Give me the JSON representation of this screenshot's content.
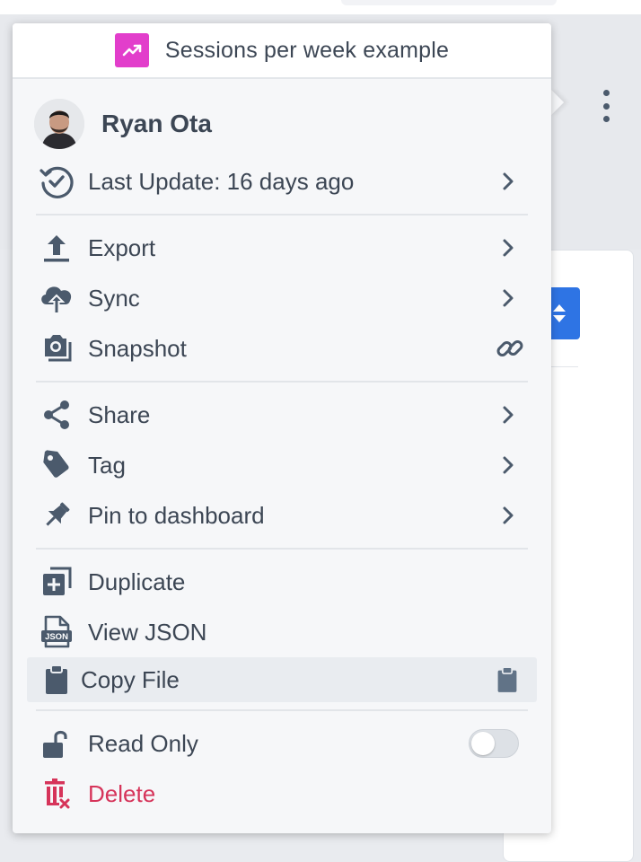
{
  "colors": {
    "text": "#3c4654",
    "icon": "#4b5a6c",
    "chart_badge": "#e23ecb",
    "danger": "#d6345a",
    "accent_blue": "#2e74e4"
  },
  "header": {
    "icon": "line-chart-icon",
    "title": "Sessions per week example"
  },
  "user": {
    "name": "Ryan Ota"
  },
  "menu": {
    "last_update": {
      "label": "Last Update: 16 days ago",
      "icon": "history-check-icon"
    },
    "export": {
      "label": "Export",
      "icon": "upload-icon"
    },
    "sync": {
      "label": "Sync",
      "icon": "cloud-upload-icon"
    },
    "snapshot": {
      "label": "Snapshot",
      "icon": "camera-icon",
      "trailing_icon": "link-icon"
    },
    "share": {
      "label": "Share",
      "icon": "share-icon"
    },
    "tag": {
      "label": "Tag",
      "icon": "tag-icon"
    },
    "pin": {
      "label": "Pin to dashboard",
      "icon": "pin-icon"
    },
    "duplicate": {
      "label": "Duplicate",
      "icon": "duplicate-icon"
    },
    "view_json": {
      "label": "View JSON",
      "icon": "json-file-icon",
      "icon_text": "JSON"
    },
    "copy_file": {
      "label": "Copy File",
      "icon": "clipboard-icon"
    },
    "read_only": {
      "label": "Read Only",
      "icon": "unlock-icon",
      "enabled": false
    },
    "delete": {
      "label": "Delete",
      "icon": "trash-icon"
    }
  }
}
